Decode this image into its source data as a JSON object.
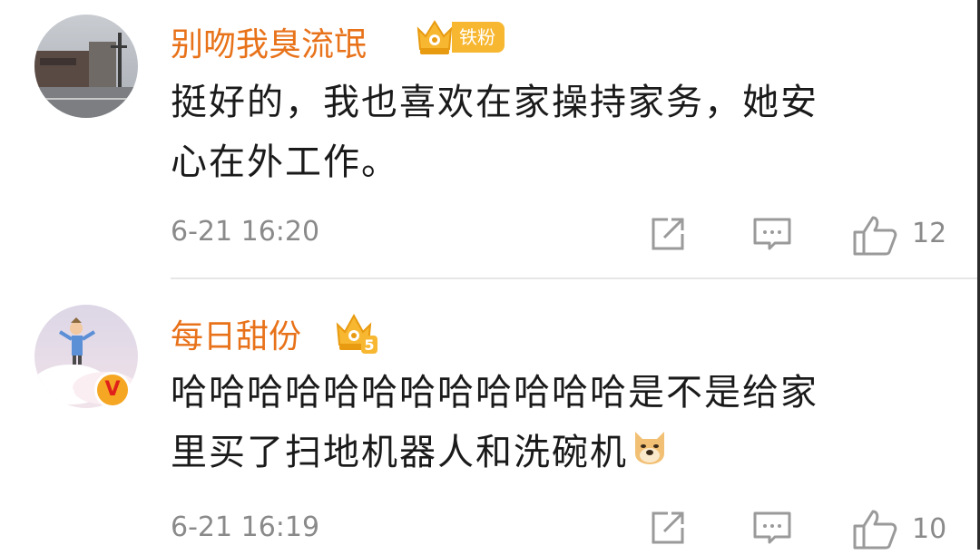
{
  "comments": [
    {
      "username": "别吻我臭流氓",
      "fan_badge": "铁粉",
      "text_line1": "挺好的，我也喜欢在家操持家务，她安",
      "text_line2": "心在外工作。",
      "time": "6-21 16:20",
      "likes": "12"
    },
    {
      "username": "每日甜份",
      "crown_level": "5",
      "verified_mark": "V",
      "text_line1": "哈哈哈哈哈哈哈哈哈哈哈哈是不是给家",
      "text_line2": "里买了扫地机器人和洗碗机",
      "time": "6-21 16:19",
      "likes": "10"
    }
  ],
  "colors": {
    "username": "#e8721a",
    "badge": "#f7b731",
    "meta": "#8a8a8a",
    "icon": "#9a9a9a"
  },
  "icons": [
    "share-icon",
    "comment-icon",
    "like-icon",
    "crown-icon",
    "doge-emoji"
  ]
}
